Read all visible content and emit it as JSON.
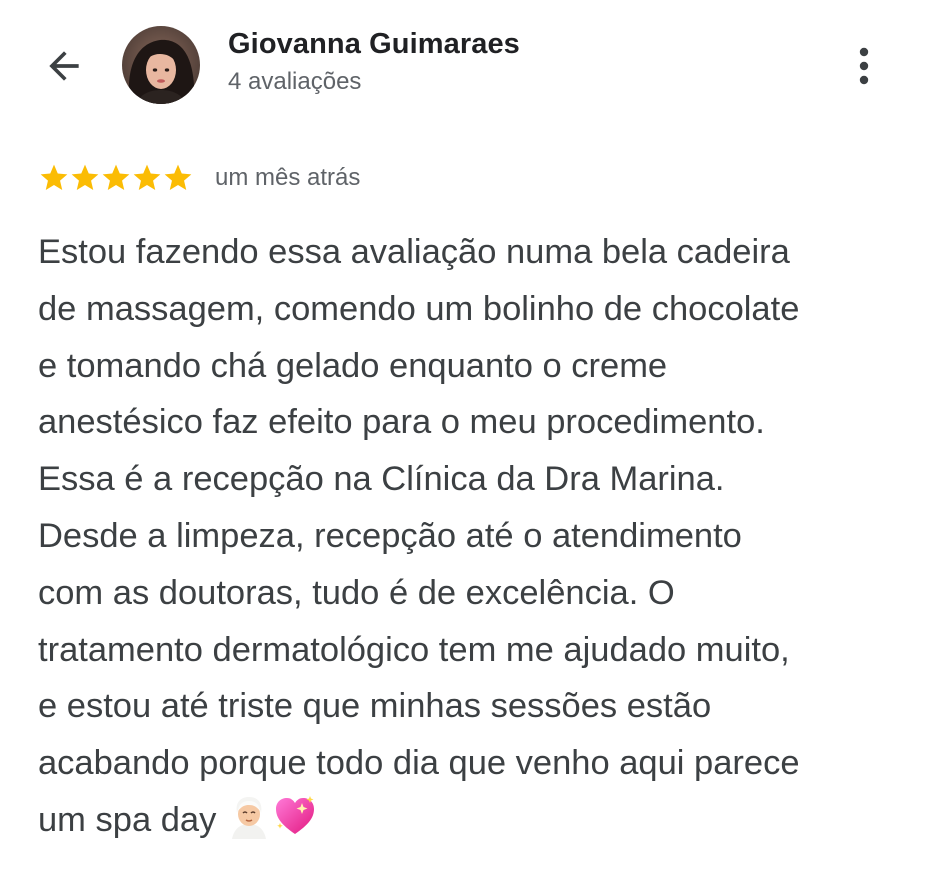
{
  "header": {
    "back_icon": "arrow-left-icon",
    "reviewer_name": "Giovanna Guimaraes",
    "review_count": "4 avaliações",
    "more_icon": "more-vert-icon"
  },
  "review": {
    "rating": 5,
    "max_rating": 5,
    "star_color": "#fbbc04",
    "date": "um mês atrás",
    "lines": [
      "Estou fazendo essa avaliação numa bela cadeira",
      "de massagem, comendo um bolinho de chocolate",
      "e tomando chá gelado enquanto o creme",
      "anestésico faz efeito para o meu procedimento.",
      "Essa é a recepção na Clínica da Dra Marina.",
      "Desde a limpeza, recepção até o atendimento",
      "com as doutoras, tudo é de excelência. O",
      "tratamento dermatológico tem me ajudado muito,",
      "e estou até triste que minhas sessões estão",
      "acabando porque todo dia que venho aqui parece",
      "um spa day"
    ],
    "trailing_emojis": [
      "person-in-steamy-room-emoji",
      "sparkling-heart-emoji"
    ]
  }
}
